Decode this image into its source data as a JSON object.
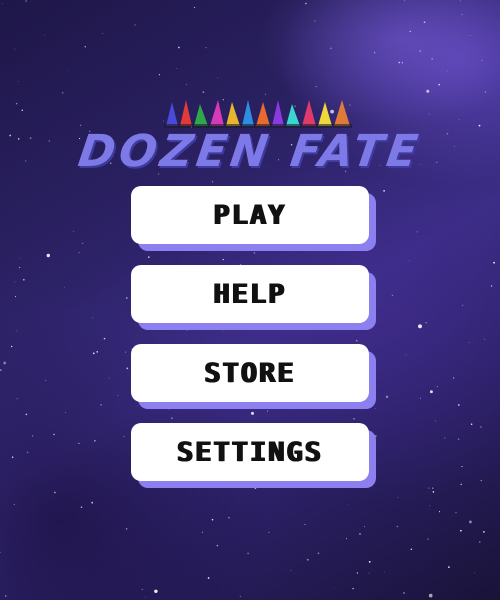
{
  "game": {
    "title": "DOZEN FATE"
  },
  "menu": {
    "play": "PLAY",
    "help": "HELP",
    "store": "STORE",
    "settings": "SETTINGS"
  },
  "colors": {
    "button_bg": "#ffffff",
    "button_shadow": "#8c7ff0",
    "title": "#7d7ae8",
    "space": "#2c2266"
  },
  "icons": {
    "logo_ships": "spaceship-fleet-icon"
  }
}
